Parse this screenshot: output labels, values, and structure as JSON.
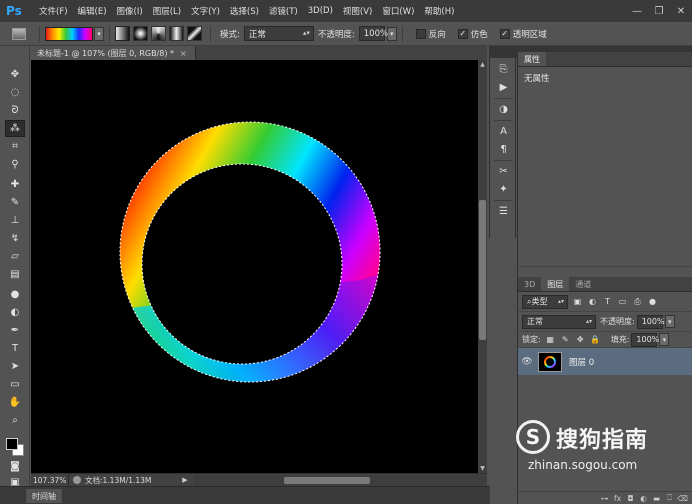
{
  "app": {
    "logo": "Ps"
  },
  "menu": [
    "文件(F)",
    "编辑(E)",
    "图像(I)",
    "图层(L)",
    "文字(Y)",
    "选择(S)",
    "滤镜(T)",
    "3D(D)",
    "视图(V)",
    "窗口(W)",
    "帮助(H)"
  ],
  "window_controls": {
    "minimize": "—",
    "restore": "❐",
    "close": "✕"
  },
  "options": {
    "mode_label": "模式:",
    "mode_value": "正常",
    "opacity_label": "不透明度:",
    "opacity_value": "100%",
    "reverse_label": "反向",
    "dither_label": "仿色",
    "transparency_label": "透明区域",
    "reverse_checked": false,
    "dither_checked": true,
    "transparency_checked": true
  },
  "document": {
    "tab_title": "未标题-1 @ 107% (图层 0, RGB/8) *",
    "tab_close": "×"
  },
  "status": {
    "zoom": "107.37%",
    "doc_info": "文档:1.13M/1.13M",
    "arrow": "▶"
  },
  "timeline": {
    "label": "时间轴"
  },
  "properties_panel": {
    "tab": "属性",
    "content": "无属性"
  },
  "layers_panel": {
    "tabs": [
      "3D",
      "图层",
      "通道"
    ],
    "active_tab": 1,
    "filter_kind": "类型",
    "blend_mode": "正常",
    "opacity_label": "不透明度:",
    "opacity_value": "100%",
    "lock_label": "锁定:",
    "fill_label": "填充:",
    "fill_value": "100%",
    "layers": [
      {
        "name": "图层 0",
        "visible": true
      }
    ]
  },
  "watermark": {
    "logo_letter": "S",
    "title": "搜狗指南",
    "url": "zhinan.sogou.com"
  },
  "colors": {
    "foreground": "#000000",
    "background": "#ffffff",
    "selected_layer": "#5c6c80"
  }
}
